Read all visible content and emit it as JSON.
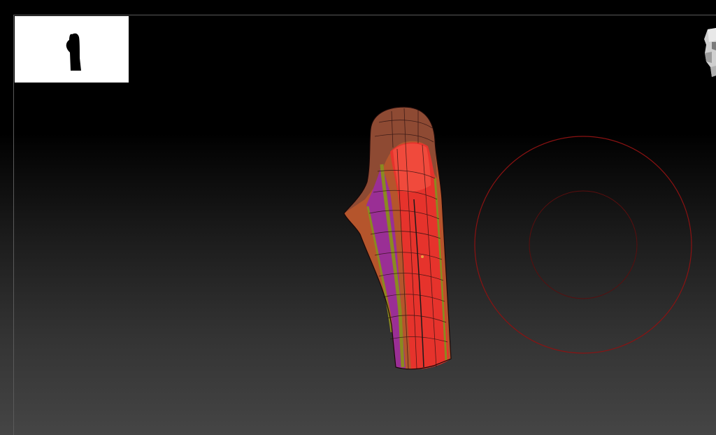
{
  "app": {
    "view": "3d-viewport",
    "background": "gradient-dark",
    "colors": {
      "brush_ring": "#8b1212",
      "frame_line": "#5a5a5a",
      "polygroup_red": "#e8302b",
      "polygroup_purple": "#a0309a",
      "polygroup_orange": "#c8612e",
      "polygroup_brown": "#9c5034",
      "polygroup_olive": "#8a8a20"
    }
  },
  "navigator": {
    "icon": "model-silhouette-icon"
  },
  "orientation_gizmo": {
    "icon": "head-orientation-icon"
  },
  "model": {
    "icon": "polygroup-mesh"
  },
  "brush_cursor": {
    "icon": "brush-radius-circles"
  }
}
